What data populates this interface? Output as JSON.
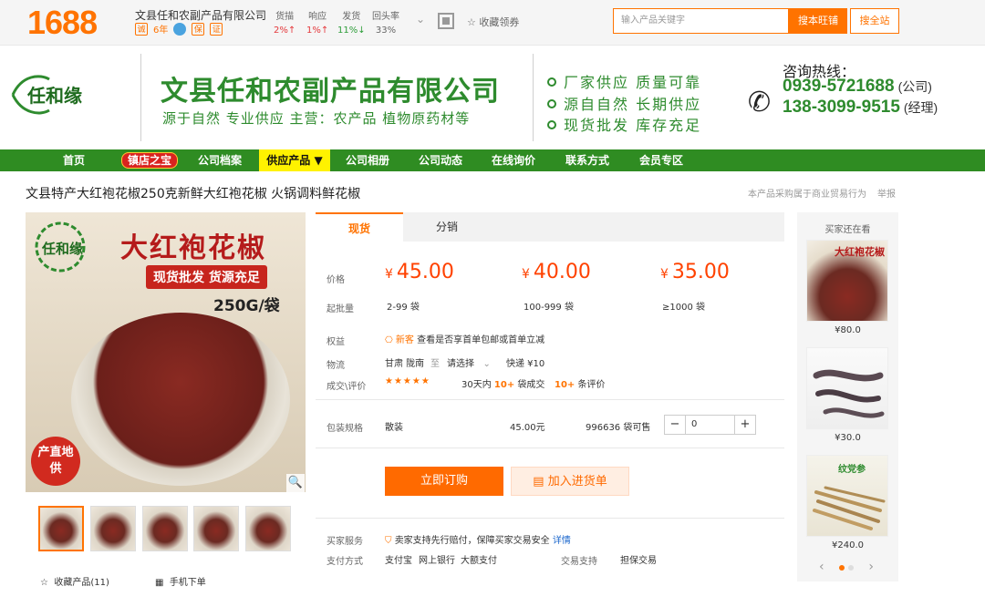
{
  "topbar": {
    "logo": "1688",
    "company": "文县任和农副产品有限公司",
    "years": "6年",
    "stats": [
      {
        "label": "货描",
        "value": "2%↑"
      },
      {
        "label": "响应",
        "value": "1%↑"
      },
      {
        "label": "发货",
        "value": "11%↓"
      },
      {
        "label": "回头率",
        "value": "33%"
      }
    ],
    "collect": "收藏领券",
    "search_placeholder": "输入产品关键字",
    "search_shop": "搜本旺铺",
    "search_all": "搜全站"
  },
  "banner": {
    "brand": "任和缘",
    "title": "文县任和农副产品有限公司",
    "subtitle": "源于自然 专业供应 主营：农产品 植物原药材等",
    "features": [
      "厂家供应 质量可靠",
      "源自自然 长期供应",
      "现货批发 库存充足"
    ],
    "hotline_label": "咨询热线：",
    "phones": [
      {
        "number": "0939-5721688",
        "note": "(公司)"
      },
      {
        "number": "138-3099-9515",
        "note": "(经理)"
      }
    ]
  },
  "nav": {
    "items": [
      "首页",
      "镇店之宝",
      "公司档案",
      "供应产品 ▼",
      "公司相册",
      "公司动态",
      "在线询价",
      "联系方式",
      "会员专区"
    ]
  },
  "product": {
    "title": "文县特产大红袍花椒250克新鲜大红袍花椒 火锅调料鲜花椒",
    "note": "本产品采购属于商业贸易行为",
    "report": "举报",
    "image": {
      "logo": "任和缘",
      "title": "大红袍花椒",
      "banner": "现货批发 货源充足",
      "weight": "250G/袋",
      "seal": "产直地供"
    },
    "favorite": "收藏产品(11)",
    "mobile_order": "手机下单"
  },
  "offer": {
    "tabs": [
      "现货",
      "分销"
    ],
    "price_label": "价格",
    "batch_label": "起批量",
    "prices": [
      {
        "price": "45.00",
        "batch": "2-99 袋"
      },
      {
        "price": "40.00",
        "batch": "100-999 袋"
      },
      {
        "price": "35.00",
        "batch": "≥1000 袋"
      }
    ],
    "currency": "¥",
    "rights_label": "权益",
    "rights_tag": "新客",
    "rights_text": "查看是否享首单包邮或首单立减",
    "shipping_label": "物流",
    "ship_from": "甘肃 陇南",
    "ship_to_sep": "至",
    "ship_to": "请选择",
    "express": "快递 ¥10",
    "review_label": "成交\\评价",
    "stars": "★★★★★",
    "sold_prefix": "30天内",
    "sold_count": "10+",
    "sold_suffix": "袋成交",
    "review_count": "10+",
    "review_suffix": "条评价",
    "spec_label": "包装规格",
    "spec_value": "散装",
    "spec_price": "45.00元",
    "stock": "996636 袋可售",
    "quantity": "0",
    "buy_now": "立即订购",
    "add_to_cart": "加入进货单",
    "service_label": "买家服务",
    "service_text": "卖家支持先行赔付，保障买家交易安全",
    "service_link": "详情",
    "payment_label": "支付方式",
    "payment_methods": [
      "支付宝",
      "网上银行",
      "大额支付"
    ],
    "trade_label": "交易支持",
    "trade_value": "担保交易"
  },
  "sidebar": {
    "title": "买家还在看",
    "items": [
      {
        "price": "¥80.0",
        "caption": "大红袍花椒"
      },
      {
        "price": "¥30.0",
        "caption": ""
      },
      {
        "price": "¥240.0",
        "caption": "纹党参"
      }
    ],
    "prev": "‹",
    "next": "›"
  },
  "colors": {
    "accent": "#ff7300",
    "brand_green": "#2f8c22",
    "price_red": "#ff4200"
  }
}
